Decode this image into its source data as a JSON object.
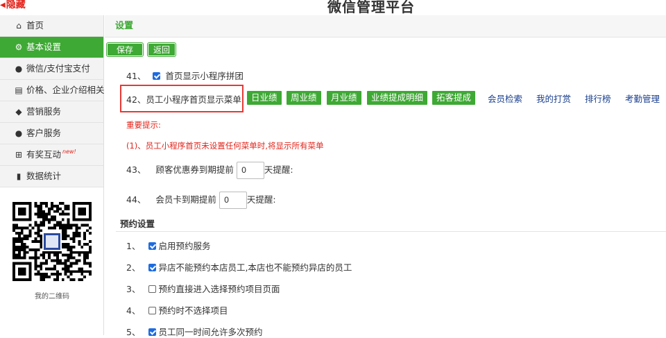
{
  "header": {
    "hide_label": "隐藏",
    "brand": "微信管理平台"
  },
  "sidebar": {
    "items": [
      {
        "label": "首页",
        "icon": "home-icon"
      },
      {
        "label": "基本设置",
        "icon": "gear-icon",
        "active": true
      },
      {
        "label": "微信/支付宝支付",
        "icon": "money-bag-icon"
      },
      {
        "label": "价格、企业介绍相关",
        "icon": "document-icon"
      },
      {
        "label": "营销服务",
        "icon": "tag-icon"
      },
      {
        "label": "客户服务",
        "icon": "user-icon"
      },
      {
        "label": "有奖互动",
        "icon": "gift-icon",
        "badge": "new!"
      },
      {
        "label": "数据统计",
        "icon": "bar-chart-icon"
      }
    ],
    "qr_caption": "我的二维码"
  },
  "main": {
    "section_title": "设置",
    "buttons": {
      "save": "保存",
      "back": "返回"
    },
    "item41": {
      "num": "41、",
      "label": "首页显示小程序拼团",
      "checked": true
    },
    "item42": {
      "num": "42、",
      "label": "员工小程序首页显示菜单"
    },
    "menu_buttons": [
      "日业绩",
      "周业绩",
      "月业绩",
      "业绩提成明细",
      "拓客提成"
    ],
    "menu_links": [
      "会员检索",
      "我的打赏",
      "排行榜",
      "考勤管理"
    ],
    "notice_title": "重要提示:",
    "notice_text": "(1)、员工小程序首页未设置任何菜单时,将显示所有菜单",
    "item43": {
      "num": "43、",
      "prefix": "顾客优惠券到期提前",
      "value": "0",
      "suffix": "天提醒:"
    },
    "item44": {
      "num": "44、",
      "prefix": "会员卡到期提前",
      "value": "0",
      "suffix": "天提醒:"
    },
    "booking_title": "预约设置",
    "booking": [
      {
        "num": "1、",
        "label": "启用预约服务",
        "checked": true
      },
      {
        "num": "2、",
        "label": "异店不能预约本店员工,本店也不能预约异店的员工",
        "checked": true
      },
      {
        "num": "3、",
        "label": "预约直接进入选择预约项目页面",
        "checked": false
      },
      {
        "num": "4、",
        "label": "预约时不选择项目",
        "checked": false
      },
      {
        "num": "5、",
        "label": "员工同一时间允许多次预约",
        "checked": true
      }
    ]
  },
  "colors": {
    "accent": "#3ea934",
    "alert": "#e2231a",
    "link": "#1a3f8f",
    "highlight": "#e53935"
  }
}
